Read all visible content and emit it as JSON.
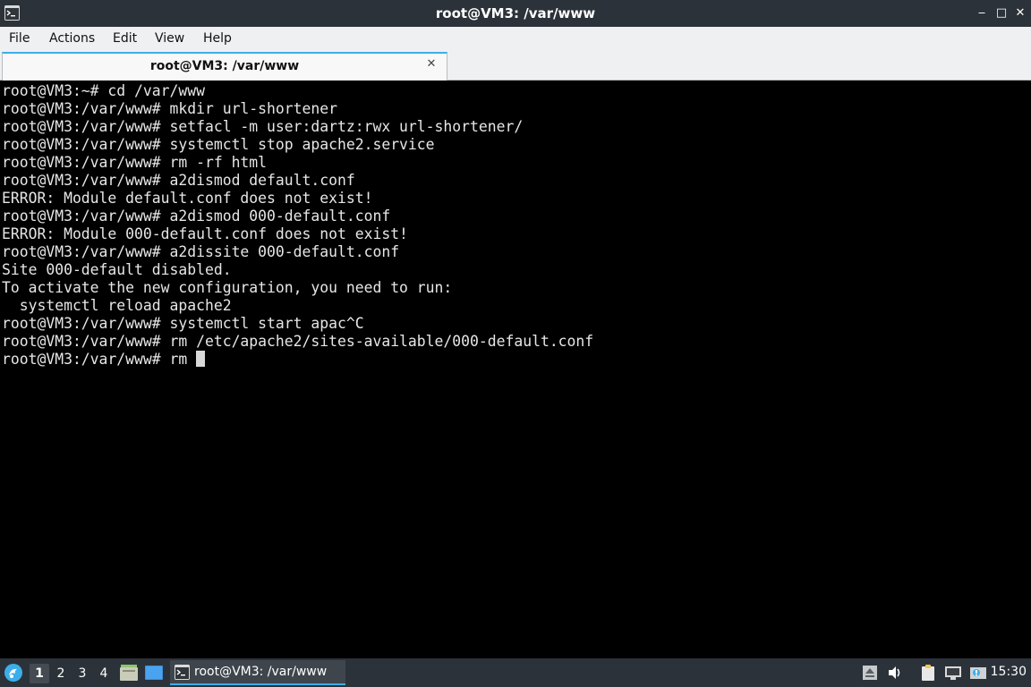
{
  "window": {
    "title": "root@VM3: /var/www",
    "minimize_glyph": "‒",
    "maximize_glyph": "□",
    "close_glyph": "✕"
  },
  "menu": {
    "file": "File",
    "actions": "Actions",
    "edit": "Edit",
    "view": "View",
    "help": "Help"
  },
  "tab": {
    "label": "root@VM3: /var/www",
    "close_glyph": "✕"
  },
  "terminal": {
    "lines": [
      "root@VM3:~# cd /var/www",
      "root@VM3:/var/www# mkdir url-shortener",
      "root@VM3:/var/www# setfacl -m user:dartz:rwx url-shortener/",
      "root@VM3:/var/www# systemctl stop apache2.service",
      "root@VM3:/var/www# rm -rf html",
      "root@VM3:/var/www# a2dismod default.conf",
      "ERROR: Module default.conf does not exist!",
      "root@VM3:/var/www# a2dismod 000-default.conf",
      "ERROR: Module 000-default.conf does not exist!",
      "root@VM3:/var/www# a2dissite 000-default.conf",
      "Site 000-default disabled.",
      "To activate the new configuration, you need to run:",
      "  systemctl reload apache2",
      "root@VM3:/var/www# systemctl start apac^C",
      "root@VM3:/var/www# rm /etc/apache2/sites-available/000-default.conf"
    ],
    "current_input": "root@VM3:/var/www# rm "
  },
  "taskbar": {
    "desktops": [
      "1",
      "2",
      "3",
      "4"
    ],
    "active_desktop": "1",
    "task_label": "root@VM3: /var/www",
    "clock": "15:30"
  },
  "icons": {
    "app": "terminal-icon",
    "start_menu": "lxqt-menu-icon",
    "file_manager": "file-manager-icon",
    "show_desktop": "show-desktop-icon",
    "volume": "volume-icon",
    "network": "network-icon"
  },
  "colors": {
    "titlebar": "#2c3239",
    "accent": "#3daee9",
    "terminal_bg": "#000000",
    "terminal_fg": "#e6e6e6"
  }
}
